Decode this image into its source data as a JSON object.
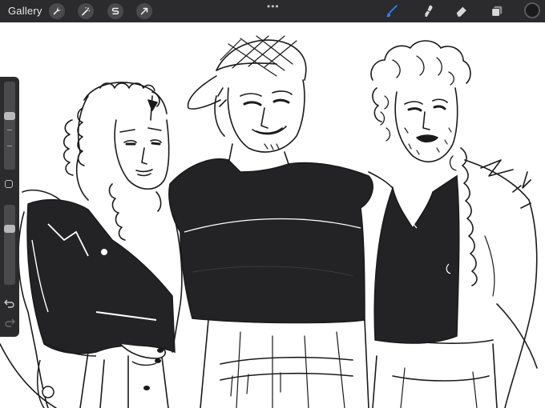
{
  "topbar": {
    "gallery_label": "Gallery",
    "left_tools": [
      {
        "name": "actions",
        "icon": "wrench-icon"
      },
      {
        "name": "adjustments",
        "icon": "magic-wand-icon"
      },
      {
        "name": "selection",
        "icon": "selection-s-icon"
      },
      {
        "name": "transform",
        "icon": "cursor-arrow-icon"
      }
    ],
    "more_label": "•••",
    "right_tools": [
      {
        "name": "brush",
        "icon": "brush-icon",
        "active": true
      },
      {
        "name": "smudge",
        "icon": "smudge-icon",
        "active": false
      },
      {
        "name": "eraser",
        "icon": "eraser-icon",
        "active": false
      },
      {
        "name": "layers",
        "icon": "layers-icon",
        "active": false
      }
    ],
    "current_color": "#1a1a1c",
    "accent_color": "#2f80ff"
  },
  "sidebar": {
    "brush_size_level": 0.62,
    "opacity_level": 0.72,
    "undo_icon": "undo-arrow-icon",
    "redo_icon": "redo-arrow-icon",
    "modify_icon": "square-modify-icon"
  },
  "canvas": {
    "description_icon": "artwork-drawing"
  }
}
